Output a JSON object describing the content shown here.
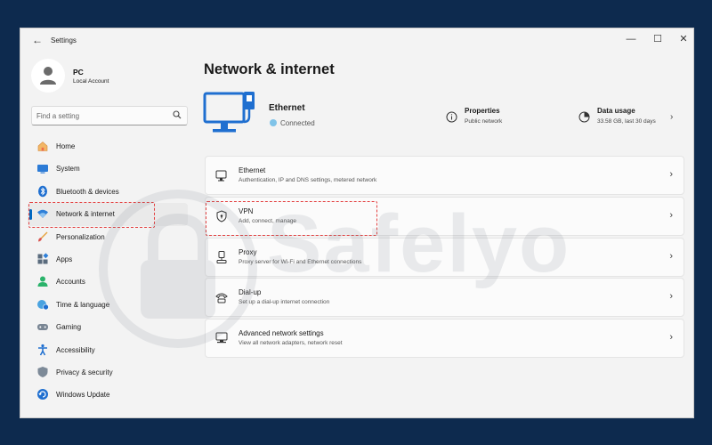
{
  "window": {
    "title": "Settings",
    "back_glyph": "←",
    "minimize_glyph": "—",
    "maximize_glyph": "☐",
    "close_glyph": "✕"
  },
  "profile": {
    "name": "PC",
    "subtitle": "Local Account"
  },
  "search": {
    "placeholder": "Find a setting",
    "value": ""
  },
  "sidebar": {
    "items": [
      {
        "label": "Home",
        "icon": "home-icon",
        "active": false
      },
      {
        "label": "System",
        "icon": "system-icon",
        "active": false
      },
      {
        "label": "Bluetooth & devices",
        "icon": "bluetooth-icon",
        "active": false
      },
      {
        "label": "Network & internet",
        "icon": "wifi-icon",
        "active": true
      },
      {
        "label": "Personalization",
        "icon": "brush-icon",
        "active": false
      },
      {
        "label": "Apps",
        "icon": "apps-icon",
        "active": false
      },
      {
        "label": "Accounts",
        "icon": "accounts-icon",
        "active": false
      },
      {
        "label": "Time & language",
        "icon": "globe-clock-icon",
        "active": false
      },
      {
        "label": "Gaming",
        "icon": "gamepad-icon",
        "active": false
      },
      {
        "label": "Accessibility",
        "icon": "accessibility-icon",
        "active": false
      },
      {
        "label": "Privacy & security",
        "icon": "shield-icon",
        "active": false
      },
      {
        "label": "Windows Update",
        "icon": "update-icon",
        "active": false
      }
    ]
  },
  "main": {
    "title": "Network & internet",
    "ethernet": {
      "name": "Ethernet",
      "status": "Connected"
    },
    "properties": {
      "title": "Properties",
      "subtitle": "Public network"
    },
    "data_usage": {
      "title": "Data usage",
      "subtitle": "33.58 GB, last 30 days"
    },
    "cards": [
      {
        "title": "Ethernet",
        "subtitle": "Authentication, IP and DNS settings, metered network",
        "icon": "ethernet-icon"
      },
      {
        "title": "VPN",
        "subtitle": "Add, connect, manage",
        "icon": "vpn-shield-icon"
      },
      {
        "title": "Proxy",
        "subtitle": "Proxy server for Wi-Fi and Ethernet connections",
        "icon": "proxy-icon"
      },
      {
        "title": "Dial-up",
        "subtitle": "Set up a dial-up internet connection",
        "icon": "dialup-icon"
      },
      {
        "title": "Advanced network settings",
        "subtitle": "View all network adapters, network reset",
        "icon": "advanced-network-icon"
      }
    ],
    "chevron": "›"
  },
  "watermark": {
    "text": "Safelyo"
  },
  "colors": {
    "accent": "#0067c0",
    "highlight": "#e34040",
    "background": "#0d2a4e"
  }
}
